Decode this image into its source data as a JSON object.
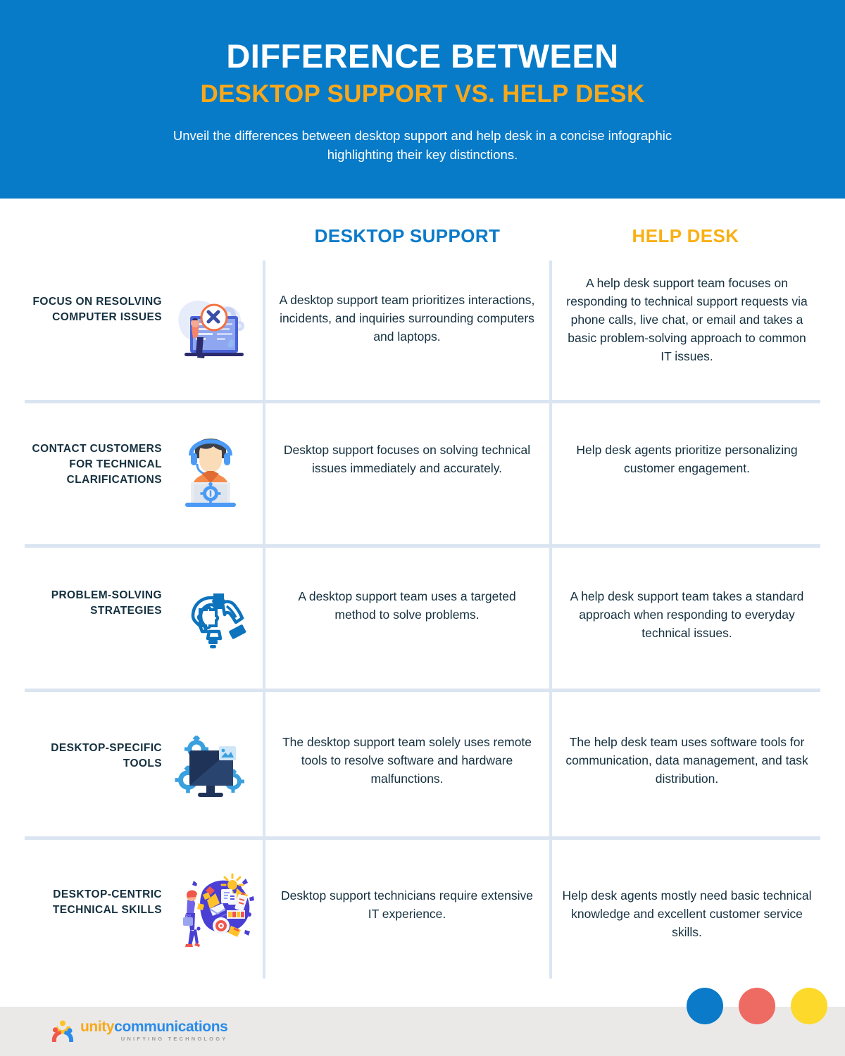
{
  "header": {
    "title_main": "DIFFERENCE BETWEEN",
    "title_sub": "DESKTOP SUPPORT VS. HELP DESK",
    "description": "Unveil the differences between desktop support and help desk in a concise infographic highlighting their key distinctions.",
    "bg_color": "#077bc8",
    "title_color": "#ffffff",
    "subtitle_color": "#f9a81a"
  },
  "columns": {
    "desktop_support": "DESKTOP SUPPORT",
    "help_desk": "HELP DESK",
    "desktop_support_color": "#0b7bc9",
    "help_desk_color": "#f9b013"
  },
  "rows": [
    {
      "label": "FOCUS ON RESOLVING COMPUTER ISSUES",
      "icon": "laptop-repair-tools-icon",
      "desktop_support": "A desktop support team prioritizes interactions, incidents, and inquiries surrounding computers and laptops.",
      "help_desk": "A help desk support team focuses on responding to technical support requests via phone calls, live chat, or email and takes a basic problem-solving approach to common IT issues."
    },
    {
      "label": "CONTACT CUSTOMERS FOR TECHNICAL CLARIFICATIONS",
      "icon": "headset-agent-laptop-icon",
      "desktop_support": "Desktop support focuses on solving technical issues immediately and accurately.",
      "help_desk": "Help desk agents prioritize personalizing customer engagement."
    },
    {
      "label": "PROBLEM-SOLVING STRATEGIES",
      "icon": "puzzle-lightbulb-hand-icon",
      "desktop_support": "A desktop support team uses a targeted method to solve problems.",
      "help_desk": "A help desk support team takes a standard approach when responding to everyday technical issues."
    },
    {
      "label": "DESKTOP-SPECIFIC TOOLS",
      "icon": "monitor-gears-icon",
      "desktop_support": "The desktop support team solely uses remote tools to resolve software and hardware malfunctions.",
      "help_desk": "The help desk team uses software tools for communication, data management, and task distribution."
    },
    {
      "label": "DESKTOP-CENTRIC TECHNICAL SKILLS",
      "icon": "person-skills-collage-icon",
      "desktop_support": "Desktop support technicians require extensive IT experience.",
      "help_desk": "Help desk agents mostly need basic technical knowledge and excellent customer service skills."
    }
  ],
  "footer": {
    "logo_unity": "unity",
    "logo_communications": "communications",
    "logo_tagline": "UNIFYING TECHNOLOGY",
    "bg_color": "#eae9e7",
    "dots": [
      {
        "name": "blue",
        "color": "#0b7bc9"
      },
      {
        "name": "red",
        "color": "#ee6b64"
      },
      {
        "name": "yellow",
        "color": "#fcd92b"
      }
    ]
  }
}
